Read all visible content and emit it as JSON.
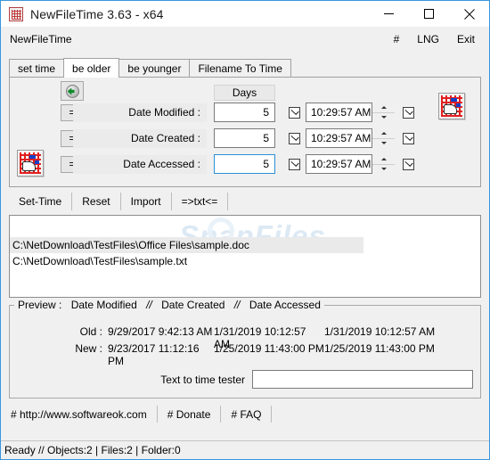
{
  "window": {
    "title": "NewFileTime 3.63 - x64",
    "icon": "app-grid-icon",
    "controls": {
      "minimize": "minimize-icon",
      "maximize": "maximize-icon",
      "close": "close-icon"
    }
  },
  "menubar": {
    "left_label": "NewFileTime",
    "right_items": [
      {
        "label": "#",
        "name": "menu-hash"
      },
      {
        "label": "LNG",
        "name": "menu-language"
      },
      {
        "label": "Exit",
        "name": "menu-exit"
      }
    ]
  },
  "tabs": [
    {
      "label": "set time",
      "active": false
    },
    {
      "label": "be older",
      "active": true
    },
    {
      "label": "be younger",
      "active": false
    },
    {
      "label": "Filename To Time",
      "active": false
    }
  ],
  "form": {
    "days_header": "Days",
    "refresh_icon": "globe-refresh-icon",
    "left_grid_icon": "grid-hand-icon",
    "right_grid_icon": "grid-hand-icon",
    "rows": [
      {
        "operator": "=",
        "label": "Date Modified :",
        "days": "5",
        "days_focused": false,
        "time_checkbox": true,
        "time": "10:29:57 AM",
        "enable_checkbox": true
      },
      {
        "operator": "=",
        "label": "Date Created :",
        "days": "5",
        "days_focused": false,
        "time_checkbox": true,
        "time": "10:29:57 AM",
        "enable_checkbox": true
      },
      {
        "operator": "=",
        "label": "Date Accessed :",
        "days": "5",
        "days_focused": true,
        "time_checkbox": true,
        "time": "10:29:57 AM",
        "enable_checkbox": true
      }
    ]
  },
  "actions": [
    {
      "label": "Set-Time",
      "name": "set-time-button"
    },
    {
      "label": "Reset",
      "name": "reset-button"
    },
    {
      "label": "Import",
      "name": "import-button"
    },
    {
      "label": "=>txt<=",
      "name": "export-txt-button"
    }
  ],
  "file_list": {
    "watermark": "SnapFiles",
    "items": [
      {
        "path": "C:\\NetDownload\\TestFiles\\Office Files\\sample.doc",
        "selected": true
      },
      {
        "path": "C:\\NetDownload\\TestFiles\\sample.txt",
        "selected": false
      }
    ]
  },
  "preview": {
    "label_prefix": "Preview :",
    "columns": [
      "Date Modified",
      "Date Created",
      "Date Accessed"
    ],
    "separator": "//",
    "old": {
      "key": "Old :",
      "date_modified": "9/29/2017 9:42:13 AM",
      "date_created": "1/31/2019 10:12:57 AM",
      "date_accessed": "1/31/2019 10:12:57 AM"
    },
    "new": {
      "key": "New :",
      "date_modified": "9/23/2017 11:12:16 PM",
      "date_created": "1/25/2019 11:43:00 PM",
      "date_accessed": "1/25/2019 11:43:00 PM"
    },
    "tester": {
      "label": "Text to time tester",
      "value": "",
      "placeholder": ""
    }
  },
  "links": [
    {
      "label": "# http://www.softwareok.com",
      "name": "link-homepage"
    },
    {
      "label": "# Donate",
      "name": "link-donate"
    },
    {
      "label": "# FAQ",
      "name": "link-faq"
    }
  ],
  "status": "Ready // Objects:2 | Files:2  | Folder:0",
  "colors": {
    "window_border": "#3a96dd",
    "face": "#f0f0f0",
    "field": "#ffffff",
    "selection": "#eaeaea",
    "focus_border": "#2e8fd6",
    "icon_red": "#e02020",
    "icon_blue": "#1340c8",
    "icon_green": "#0f8a2b"
  }
}
